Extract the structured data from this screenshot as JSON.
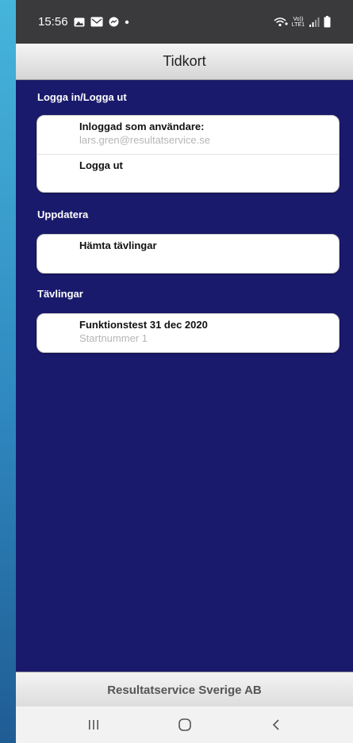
{
  "status_bar": {
    "time": "15:56",
    "volte_label_top": "Vo))",
    "volte_label_bottom": "LTE1"
  },
  "app": {
    "title": "Tidkort",
    "footer": "Resultatservice Sverige AB"
  },
  "sections": {
    "login": {
      "header": "Logga in/Logga ut",
      "logged_in_title": "Inloggad som användare:",
      "logged_in_user": "lars.gren@resultatservice.se",
      "logout_label": "Logga ut"
    },
    "update": {
      "header": "Uppdatera",
      "fetch_label": "Hämta tävlingar"
    },
    "competitions": {
      "header": "Tävlingar",
      "items": [
        {
          "title": "Funktionstest 31 dec 2020",
          "subtitle": "Startnummer 1"
        }
      ]
    }
  },
  "colors": {
    "background": "#1a1a6c",
    "status_bar": "#3a3a3c",
    "section_header_text": "#ffffff",
    "subtitle_text": "#b6b6b6"
  },
  "icons": [
    "gallery-icon",
    "mail-icon",
    "messenger-icon",
    "dot-icon",
    "wifi-calling-icon",
    "volte-icon",
    "signal-icon",
    "battery-icon",
    "recent-apps-icon",
    "home-icon",
    "back-icon"
  ]
}
